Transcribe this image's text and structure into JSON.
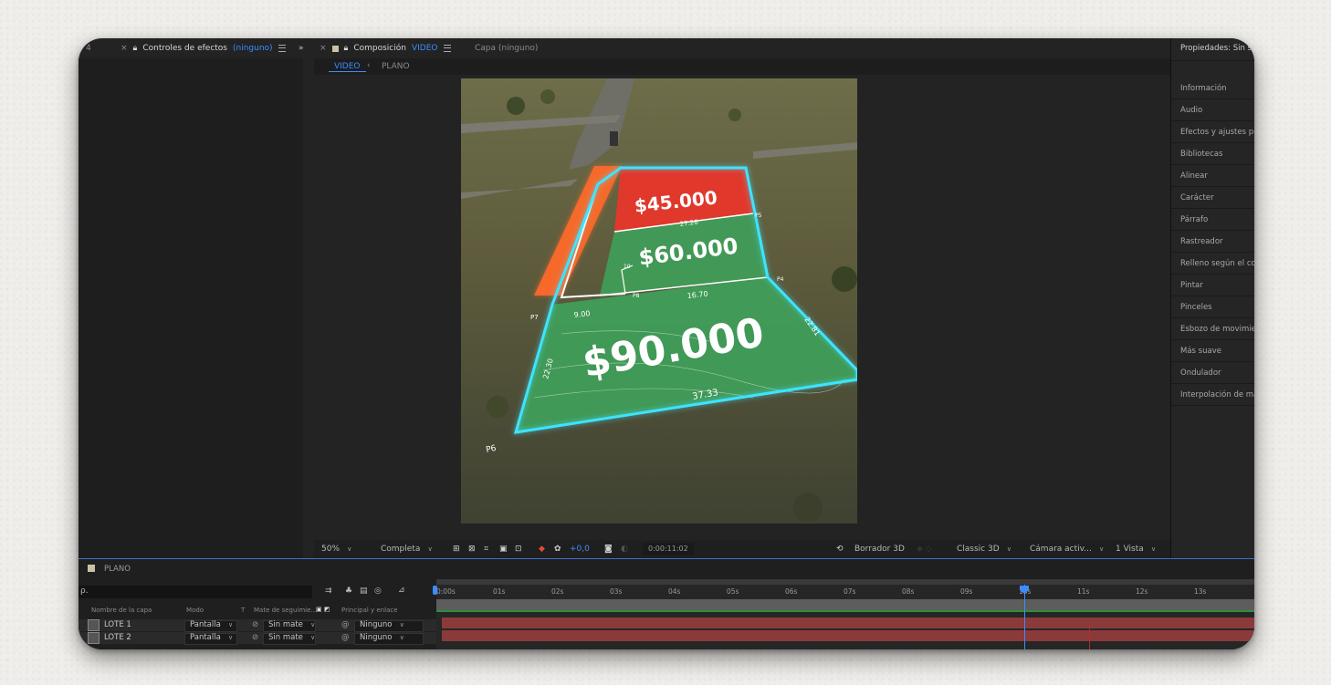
{
  "left_panel": {
    "tab_number": "4",
    "effects_title": "Controles de efectos",
    "effects_target": "(ninguno)"
  },
  "comp_panel": {
    "title": "Composición",
    "comp_name": "VIDEO",
    "layer_label": "Capa (ninguno)",
    "breadcrumb": [
      "VIDEO",
      "PLANO"
    ]
  },
  "video": {
    "prices": [
      "$45.000",
      "$60.000",
      "$90.000"
    ],
    "measures": [
      "27.26",
      "16.70",
      "9.00",
      "37.33",
      "22.81",
      "22.30",
      "10"
    ],
    "points": [
      "P7",
      "P6",
      "P4",
      "P5",
      "P8"
    ]
  },
  "comp_toolbar": {
    "zoom": "50%",
    "resolution": "Completa",
    "exposure": "+0,0",
    "timecode": "0:00:11:02",
    "draft3d": "Borrador 3D",
    "renderer": "Classic 3D",
    "camera": "Cámara activ...",
    "views": "1 Vista"
  },
  "right_panel": {
    "header": "Propiedades: Sin se",
    "items": [
      "Información",
      "Audio",
      "Efectos y ajustes pre",
      "Bibliotecas",
      "Alinear",
      "Carácter",
      "Párrafo",
      "Rastreador",
      "Relleno según el cont",
      "Pintar",
      "Pinceles",
      "Esbozo de movimien",
      "Más suave",
      "Ondulador",
      "Interpolación de más"
    ]
  },
  "timeline": {
    "comp_name": "PLANO",
    "search_placeholder": "ρ.",
    "columns": {
      "layer_name": "Nombre de la capa",
      "mode": "Modo",
      "t": "T",
      "track_matte": "Mate de seguimie...",
      "parent": "Principal y enlace"
    },
    "ruler": [
      "0:00s",
      "01s",
      "02s",
      "03s",
      "04s",
      "05s",
      "06s",
      "07s",
      "08s",
      "09s",
      "10s",
      "11s",
      "12s",
      "13s"
    ],
    "layers": [
      {
        "name": "LOTE 1",
        "mode": "Pantalla",
        "matte": "Sin mate",
        "parent": "Ninguno"
      },
      {
        "name": "LOTE 2",
        "mode": "Pantalla",
        "matte": "Sin mate",
        "parent": "Ninguno"
      }
    ]
  },
  "colors": {
    "accent": "#3d8cff",
    "price_red": "#e8362b",
    "price_green": "#3fa05a",
    "outline_cyan": "#3fe3ff",
    "orange_strip": "#ff6a2a",
    "layer_bar": "#8b3a3a"
  }
}
